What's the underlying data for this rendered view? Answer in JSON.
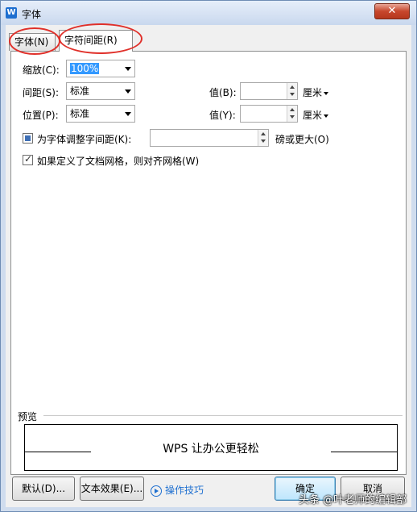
{
  "window": {
    "title": "字体",
    "app_icon_letter": "W",
    "close_label": "✕"
  },
  "tabs": [
    {
      "label": "字体(N)",
      "active": false
    },
    {
      "label": "字符间距(R)",
      "active": true
    }
  ],
  "fields": {
    "scale": {
      "label": "缩放(C):",
      "value": "100%"
    },
    "spacing": {
      "label": "间距(S):",
      "value": "标准",
      "amount_label": "值(B):",
      "amount_value": "",
      "unit": "厘米"
    },
    "position": {
      "label": "位置(P):",
      "value": "标准",
      "amount_label": "值(Y):",
      "amount_value": "",
      "unit": "厘米"
    },
    "kerning": {
      "label": "为字体调整字间距(K):",
      "value": "",
      "suffix": "磅或更大(O)",
      "state": "indeterminate"
    },
    "snap_grid": {
      "label": "如果定义了文档网格，则对齐网格(W)",
      "checked": true
    }
  },
  "preview": {
    "label": "预览",
    "sample_text": "WPS 让办公更轻松"
  },
  "buttons": {
    "default": "默认(D)...",
    "text_effects": "文本效果(E)...",
    "tips": "操作技巧",
    "ok": "确定",
    "cancel": "取消"
  },
  "watermark": "头条 @叶老师的编辑部",
  "colors": {
    "highlight_circle": "#e0302a",
    "selection": "#3399ff",
    "link": "#1e6fd0"
  }
}
